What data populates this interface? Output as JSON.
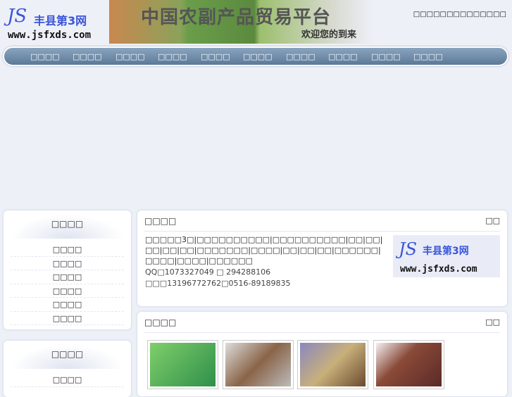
{
  "header": {
    "logo_js": "JS",
    "logo_cn": "丰县第3网",
    "logo_url": "www.jsfxds.com",
    "banner_title": "中国农副产品贸易平台",
    "banner_welcome": "欢迎您的到来",
    "top_right": "□□□□□□□□□□□□□□"
  },
  "nav": [
    "□□□□",
    "□□□□",
    "□□□□",
    "□□□□",
    "□□□□",
    "□□□□",
    "□□□□",
    "□□□□",
    "□□□□",
    "□□□□"
  ],
  "sidebar": [
    {
      "title": "□□□□",
      "items": [
        "□□□□",
        "□□□□",
        "□□□□",
        "□□□□",
        "□□□□",
        "□□□□"
      ]
    },
    {
      "title": "□□□□",
      "items": [
        "□□□□"
      ]
    }
  ],
  "about": {
    "title": "□□□□",
    "more": "□□",
    "text": "□□□□□3□|□□□□□□□□□□|□□□□□□□□□□|□□|□□|□□|□□|□□|□□□□□□□|□□□□|□□|□□|□□|□□□□□□|□□□□|□□□□|□□□□□□",
    "qq": "QQ□1073327049  □ 294288106",
    "phone": "□□□13196772762□0516-89189835"
  },
  "products": {
    "title": "□□□□",
    "more": "□□",
    "thumbs": [
      {
        "color": "#5fa84a"
      },
      {
        "color": "#9a7250"
      },
      {
        "color": "#a89060"
      },
      {
        "color": "#8a4a38"
      }
    ]
  }
}
